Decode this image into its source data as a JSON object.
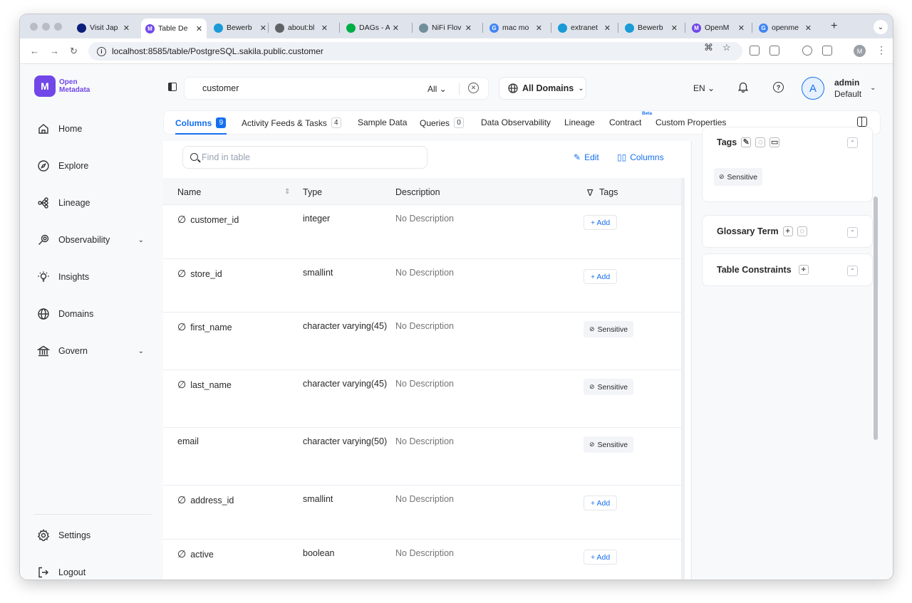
{
  "browser": {
    "tabs": [
      {
        "title": "Visit Jap",
        "color": "#0b1f7a",
        "glyph": ""
      },
      {
        "title": "Table De",
        "color": "#7147e8",
        "glyph": "M"
      },
      {
        "title": "Bewerb",
        "color": "#1a9ad6",
        "glyph": ""
      },
      {
        "title": "about:bl",
        "color": "#5f6368",
        "glyph": ""
      },
      {
        "title": "DAGs - A",
        "color": "#00ad46",
        "glyph": ""
      },
      {
        "title": "NiFi Flov",
        "color": "#728e9b",
        "glyph": ""
      },
      {
        "title": "mac mo",
        "color": "#4285f4",
        "glyph": "G"
      },
      {
        "title": "extranet",
        "color": "#1a9ad6",
        "glyph": ""
      },
      {
        "title": "Bewerb",
        "color": "#1a9ad6",
        "glyph": ""
      },
      {
        "title": "OpenM",
        "color": "#7147e8",
        "glyph": "M"
      },
      {
        "title": "openme",
        "color": "#4285f4",
        "glyph": "G"
      }
    ],
    "url": "localhost:8585/table/PostgreSQL.sakila.public.customer",
    "profile_initial": "M"
  },
  "app": {
    "logo_line1": "Open",
    "logo_line2": "Metadata",
    "logo_glyph": "M"
  },
  "sidebar": {
    "items": [
      {
        "label": "Home",
        "icon": "home-icon"
      },
      {
        "label": "Explore",
        "icon": "compass-icon"
      },
      {
        "label": "Lineage",
        "icon": "lineage-icon"
      },
      {
        "label": "Observability",
        "icon": "observability-icon",
        "chevron": true
      },
      {
        "label": "Insights",
        "icon": "bulb-icon"
      },
      {
        "label": "Domains",
        "icon": "globe-icon"
      },
      {
        "label": "Govern",
        "icon": "bank-icon",
        "chevron": true
      }
    ],
    "bottom": [
      {
        "label": "Settings",
        "icon": "gear-icon"
      },
      {
        "label": "Logout",
        "icon": "logout-icon"
      }
    ]
  },
  "topbar": {
    "search_value": "customer",
    "search_scope": "All",
    "domains_label": "All Domains",
    "language": "EN",
    "user_initial": "A",
    "user_name": "admin",
    "user_role": "Default"
  },
  "detail_tabs": [
    {
      "label": "Columns",
      "count": "9",
      "active": true
    },
    {
      "label": "Activity Feeds & Tasks",
      "count": "4"
    },
    {
      "label": "Sample Data"
    },
    {
      "label": "Queries",
      "count": "0"
    },
    {
      "label": "Data Observability"
    },
    {
      "label": "Lineage"
    },
    {
      "label": "Contract",
      "badge": "Beta"
    },
    {
      "label": "Custom Properties"
    }
  ],
  "table": {
    "find_placeholder": "Find in table",
    "edit_label": "Edit",
    "columns_label": "Columns",
    "headers": {
      "name": "Name",
      "type": "Type",
      "description": "Description",
      "tags": "Tags"
    },
    "rows": [
      {
        "name": "customer_id",
        "type": "integer",
        "description": "No Description",
        "tag": "+ Add",
        "nullable_icon": true
      },
      {
        "name": "store_id",
        "type": "smallint",
        "description": "No Description",
        "tag": "+ Add",
        "nullable_icon": true
      },
      {
        "name": "first_name",
        "type": "character varying(45)",
        "description": "No Description",
        "tag": "Sensitive",
        "nullable_icon": true
      },
      {
        "name": "last_name",
        "type": "character varying(45)",
        "description": "No Description",
        "tag": "Sensitive",
        "nullable_icon": true
      },
      {
        "name": "email",
        "type": "character varying(50)",
        "description": "No Description",
        "tag": "Sensitive",
        "nullable_icon": false
      },
      {
        "name": "address_id",
        "type": "smallint",
        "description": "No Description",
        "tag": "+ Add",
        "nullable_icon": true
      },
      {
        "name": "active",
        "type": "boolean",
        "description": "No Description",
        "tag": "+ Add",
        "nullable_icon": true
      }
    ]
  },
  "right_panel": {
    "tags_title": "Tags",
    "tags_value": "Sensitive",
    "glossary_title": "Glossary Term",
    "constraints_title": "Table Constraints"
  }
}
